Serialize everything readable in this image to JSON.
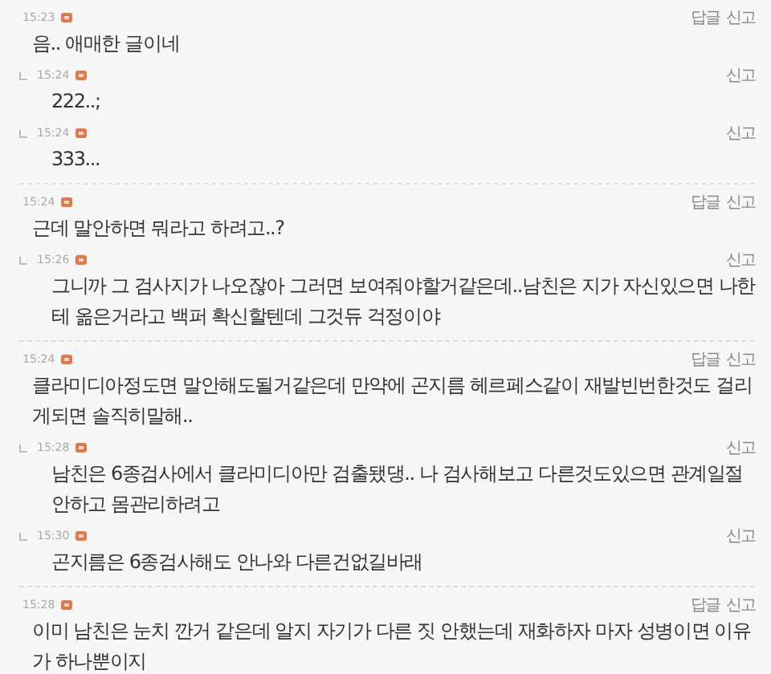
{
  "threads": [
    {
      "time": "15:23",
      "text": "음.. 애매한 글이네",
      "actions": [
        "답글",
        "신고"
      ],
      "replies": [
        {
          "time": "15:24",
          "text": "222..;",
          "actions": [
            "신고"
          ]
        },
        {
          "time": "15:24",
          "text": "333...",
          "actions": [
            "신고"
          ]
        }
      ]
    },
    {
      "time": "15:24",
      "text": "근데 말안하면 뭐라고 하려고..?",
      "actions": [
        "답글",
        "신고"
      ],
      "replies": [
        {
          "time": "15:26",
          "text": "그니까 그 검사지가 나오잖아 그러면 보여줘야할거같은데..남친은 지가 자신있으면 나한테 옮은거라고 백퍼 확신할텐데 그것듀 걱정이야",
          "actions": [
            "신고"
          ]
        }
      ]
    },
    {
      "time": "15:24",
      "text": "클라미디아정도면 말안해도될거같은데 만약에 곤지름 헤르페스같이 재발빈번한것도 걸리게되면 솔직히말해..",
      "actions": [
        "답글",
        "신고"
      ],
      "replies": [
        {
          "time": "15:28",
          "text": "남친은 6종검사에서 클라미디아만 검출됐댕.. 나 검사해보고 다른것도있으면 관계일절안하고 몸관리하려고",
          "actions": [
            "신고"
          ]
        },
        {
          "time": "15:30",
          "text": "곤지름은 6종검사해도 안나와 다른건없길바래",
          "actions": [
            "신고"
          ]
        }
      ]
    },
    {
      "time": "15:28",
      "text": "이미 남친은 눈치 깐거 같은데 알지 자기가 다른 짓 안했는데 재화하자 마자 성병이면 이유가 하나뿐이지",
      "actions": [
        "답글",
        "신고"
      ]
    }
  ]
}
